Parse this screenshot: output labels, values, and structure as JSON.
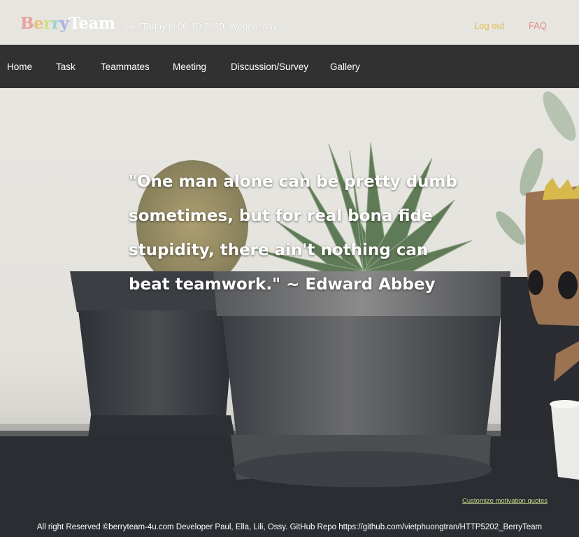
{
  "header": {
    "logo": {
      "letters": [
        {
          "char": "B",
          "color": "#e8a29c"
        },
        {
          "char": "e",
          "color": "#e6c27a"
        },
        {
          "char": "r",
          "color": "#cfe08c"
        },
        {
          "char": "r",
          "color": "#9fd3d1"
        },
        {
          "char": "y",
          "color": "#a9b4e6"
        },
        {
          "char": "T",
          "color": "#ffffff"
        },
        {
          "char": "e",
          "color": "#ffffff"
        },
        {
          "char": "a",
          "color": "#ffffff"
        },
        {
          "char": "m",
          "color": "#ffffff"
        }
      ]
    },
    "greeting": "Hi ! Today is 06-10-2020, Wednesday.",
    "logout_label": "Log out",
    "faq_label": "FAQ"
  },
  "nav": {
    "items": [
      {
        "label": "Home"
      },
      {
        "label": "Task"
      },
      {
        "label": "Teammates"
      },
      {
        "label": "Meeting"
      },
      {
        "label": "Discussion/Survey"
      },
      {
        "label": "Gallery"
      }
    ]
  },
  "hero": {
    "quote": "\"One man alone can be pretty dumb sometimes, but for real bona fide stupidity, there ain't nothing can beat teamwork.\" ~ Edward Abbey",
    "customize_label": "Customize motivation quotes"
  },
  "footer": {
    "text": "All right Reserved ©berryteam-4u.com Developer Paul, Ella, Lili, Ossy. GitHub Repo https://github.com/vietphuongtran/HTTP5202_BerryTeam"
  },
  "colors": {
    "nav_background": "#313131",
    "header_background": "#e7e5e0",
    "logout_color": "#e2bf52",
    "faq_color": "#e18a86",
    "customize_color": "#c8d88a"
  }
}
